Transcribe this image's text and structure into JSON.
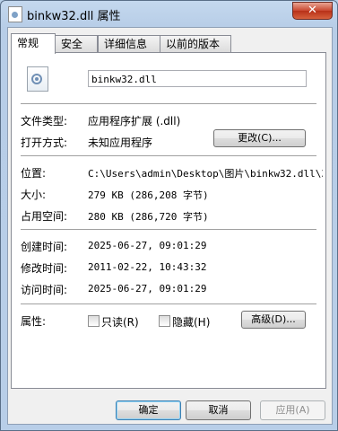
{
  "window": {
    "title": "binkw32.dll 属性",
    "close_symbol": "✕"
  },
  "tabs": [
    {
      "label": "常规",
      "active": true
    },
    {
      "label": "安全",
      "active": false
    },
    {
      "label": "详细信息",
      "active": false
    },
    {
      "label": "以前的版本",
      "active": false
    }
  ],
  "general": {
    "file_name": "binkw32.dll",
    "icon": "dll-file-icon",
    "file_type_label": "文件类型:",
    "file_type_value": "应用程序扩展 (.dll)",
    "open_with_label": "打开方式:",
    "open_with_value": "未知应用程序",
    "change_button": "更改(C)...",
    "location_label": "位置:",
    "location_value": "C:\\Users\\admin\\Desktop\\图片\\binkw32.dll\\3",
    "size_label": "大小:",
    "size_value": "279 KB (286,208 字节)",
    "size_on_disk_label": "占用空间:",
    "size_on_disk_value": "280 KB (286,720 字节)",
    "created_label": "创建时间:",
    "created_value": "2025-06-27, 09:01:29",
    "modified_label": "修改时间:",
    "modified_value": "2011-02-22, 10:43:32",
    "accessed_label": "访问时间:",
    "accessed_value": "2025-06-27, 09:01:29",
    "attributes_label": "属性:",
    "readonly_label": "只读(R)",
    "readonly_checked": false,
    "hidden_label": "隐藏(H)",
    "hidden_checked": false,
    "advanced_button": "高级(D)..."
  },
  "footer": {
    "ok_button": "确定",
    "cancel_button": "取消",
    "apply_button": "应用(A)"
  }
}
